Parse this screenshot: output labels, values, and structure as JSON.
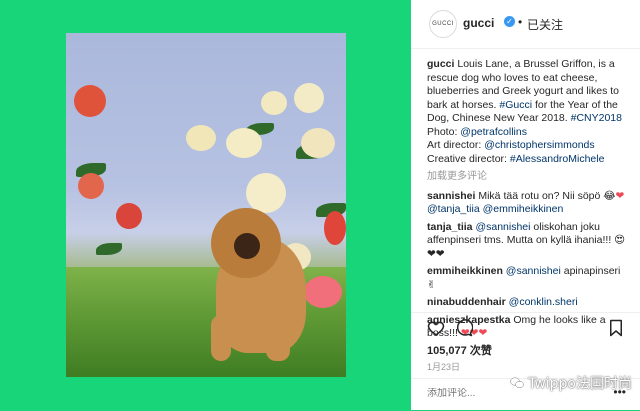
{
  "post": {
    "avatar_text": "GUCCI",
    "username": "gucci",
    "verified_mark": "✓",
    "dot": "•",
    "follow_state": "已关注",
    "caption": {
      "user": "gucci",
      "text1": " Louis Lane, a Brussel Griffon, is a rescue dog who loves to eat cheese, blueberries and Greek yogurt and likes to bark at horses. ",
      "hashtag1": "#Gucci",
      "text2": " for the Year of the Dog, Chinese New Year 2018. ",
      "hashtag2": "#CNY2018",
      "photo_label": "Photo: ",
      "photo_credit": "@petrafcollins",
      "art_label": "Art director: ",
      "art_credit": "@christophersimmonds",
      "creative_label": "Creative director: ",
      "creative_credit": "#AlessandroMichele"
    },
    "load_more": "加载更多评论",
    "comments": [
      {
        "user": "sannishei",
        "text": " Mikä tää rotu on? Nii söpö ",
        "mention": "",
        "emoji": "😂",
        "hearts": "❤"
      },
      {
        "user": "",
        "text": "",
        "mention": "@tanja_tiia @emmiheikkinen",
        "emoji": "",
        "hearts": ""
      },
      {
        "user": "tanja_tiia",
        "text": " oliskohan joku affenpinseri tms. Mutta on kyllä ihania!!! ",
        "mention": "@sannishei",
        "emoji": "😍",
        "hearts": "❤❤"
      },
      {
        "user": "emmiheikkinen",
        "text": " apinapinseri ",
        "mention": "@sannishei",
        "emoji": "✌",
        "hearts": ""
      },
      {
        "user": "ninabuddenhair",
        "text": "",
        "mention": "@conklin.sheri",
        "emoji": "",
        "hearts": ""
      },
      {
        "user": "agnieszkapestka",
        "text": " Omg he looks like a boss!!! ",
        "mention": "",
        "emoji": "",
        "hearts": "❤❤❤"
      }
    ],
    "likes": "105,077 次赞",
    "date": "1月23日",
    "add_comment_placeholder": "添加评论...",
    "more_options": "•••"
  },
  "watermark": "Twippo法国时尚",
  "colors": {
    "background": "#19d57a",
    "link": "#003569",
    "verified": "#3897f0",
    "heart": "#ed4956"
  },
  "icons": [
    "heart-icon",
    "comment-icon",
    "bookmark-icon",
    "wechat-icon",
    "verified-icon"
  ]
}
